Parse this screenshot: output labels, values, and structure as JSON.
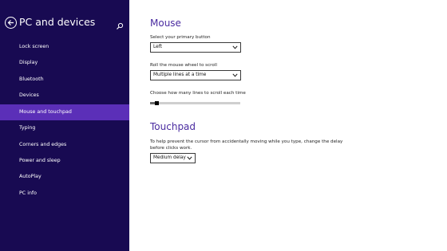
{
  "sidebar": {
    "title": "PC and devices",
    "items": [
      {
        "label": "Lock screen"
      },
      {
        "label": "Display"
      },
      {
        "label": "Bluetooth"
      },
      {
        "label": "Devices"
      },
      {
        "label": "Mouse and touchpad",
        "selected": true
      },
      {
        "label": "Typing"
      },
      {
        "label": "Corners and edges"
      },
      {
        "label": "Power and sleep"
      },
      {
        "label": "AutoPlay"
      },
      {
        "label": "PC info"
      }
    ]
  },
  "mouse": {
    "title": "Mouse",
    "primary_button_label": "Select your primary button",
    "primary_button_value": "Left",
    "wheel_label": "Roll the mouse wheel to scroll",
    "wheel_value": "Multiple lines at a time",
    "lines_label": "Choose how many lines to scroll each time",
    "lines_fraction": 0.05
  },
  "touchpad": {
    "title": "Touchpad",
    "description": "To help prevent the cursor from accidentally moving while you type, change the delay before clicks work.",
    "delay_value": "Medium delay"
  },
  "colors": {
    "sidebar_bg": "#180a52",
    "selected_bg": "#5b2fb8",
    "accent_title": "#4a2ba0"
  },
  "icons": {
    "back": "back-arrow-icon",
    "search": "search-icon",
    "dropdown": "chevron-down-icon"
  }
}
